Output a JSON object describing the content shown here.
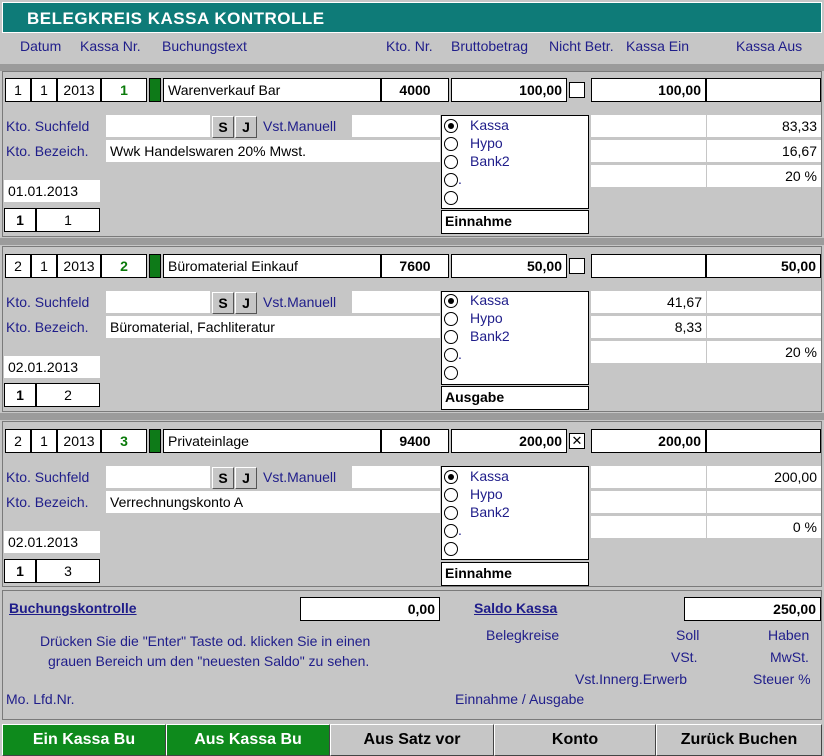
{
  "title": "BELEGKREIS KASSA KONTROLLE",
  "headers": {
    "datum": "Datum",
    "kassa_nr": "Kassa Nr.",
    "buchungstext": "Buchungstext",
    "kto_nr": "Kto. Nr.",
    "bruttobetrag": "Bruttobetrag",
    "nicht_betr": "Nicht Betr.",
    "kassa_ein": "Kassa Ein",
    "kassa_aus": "Kassa Aus"
  },
  "labels": {
    "kto_suchfeld": "Kto. Suchfeld",
    "kto_bezeich": "Kto. Bezeich.",
    "s": "S",
    "j": "J",
    "vst_manuell": "Vst.Manuell",
    "radio_kassa": "Kassa",
    "radio_hypo": "Hypo",
    "radio_bank2": "Bank2",
    "radio_dot": "."
  },
  "entries": [
    {
      "day": "1",
      "month": "1",
      "year": "2013",
      "kassa_nr": "1",
      "text": "Warenverkauf Bar",
      "kto_nr": "4000",
      "brutto": "100,00",
      "nicht_betr_checked": false,
      "kassa_ein": "100,00",
      "kassa_aus": "",
      "kto_suchfeld": "",
      "vst_manuell": "",
      "kto_bezeich": "Wwk Handelswaren 20% Mwst.",
      "date": "01.01.2013",
      "mo": "1",
      "lfd": "1",
      "soll": "",
      "haben": "83,33",
      "vst": "",
      "mwst": "16,67",
      "innerg": "",
      "steuer": "20 %",
      "type": "Einnahme",
      "selected_radio": "Kassa"
    },
    {
      "day": "2",
      "month": "1",
      "year": "2013",
      "kassa_nr": "2",
      "text": "Büromaterial Einkauf",
      "kto_nr": "7600",
      "brutto": "50,00",
      "nicht_betr_checked": false,
      "kassa_ein": "",
      "kassa_aus": "50,00",
      "kto_suchfeld": "",
      "vst_manuell": "",
      "kto_bezeich": "Büromaterial, Fachliteratur",
      "date": "02.01.2013",
      "mo": "1",
      "lfd": "2",
      "soll": "41,67",
      "haben": "",
      "vst": "8,33",
      "mwst": "",
      "innerg": "",
      "steuer": "20 %",
      "type": "Ausgabe",
      "selected_radio": "Kassa"
    },
    {
      "day": "2",
      "month": "1",
      "year": "2013",
      "kassa_nr": "3",
      "text": "Privateinlage",
      "kto_nr": "9400",
      "brutto": "200,00",
      "nicht_betr_checked": true,
      "kassa_ein": "200,00",
      "kassa_aus": "",
      "kto_suchfeld": "",
      "vst_manuell": "",
      "kto_bezeich": "Verrechnungskonto A",
      "date": "02.01.2013",
      "mo": "1",
      "lfd": "3",
      "soll": "",
      "haben": "200,00",
      "vst": "",
      "mwst": "",
      "innerg": "",
      "steuer": "0 %",
      "type": "Einnahme",
      "selected_radio": "Kassa"
    }
  ],
  "summary": {
    "buchungskontrolle_label": "Buchungskontrolle",
    "buchungskontrolle_value": "0,00",
    "saldo_kassa_label": "Saldo Kassa",
    "saldo_kassa_value": "250,00",
    "hint_line1": "Drücken Sie die \"Enter\" Taste od. klicken Sie in einen",
    "hint_line2": "grauen Bereich um den \"neuesten Saldo\" zu sehen.",
    "belegkreise": "Belegkreise",
    "soll": "Soll",
    "haben": "Haben",
    "vst": "VSt.",
    "mwst": "MwSt.",
    "innerg": "Vst.Innerg.Erwerb",
    "steuer": "Steuer %",
    "mo_lfd": "Mo. Lfd.Nr.",
    "einnahme_ausgabe": "Einnahme / Ausgabe"
  },
  "buttons": {
    "ein_kassa": "Ein Kassa Bu",
    "aus_kassa": "Aus Kassa Bu",
    "aus_satz": "Aus Satz vor",
    "konto": "Konto",
    "zurueck": "Zurück Buchen"
  },
  "colors": {
    "title_bar": "#0e7b78",
    "label_blue": "#1f1d8a",
    "green_button": "#0e8a1c",
    "panel_grey": "#c6c6c6"
  }
}
